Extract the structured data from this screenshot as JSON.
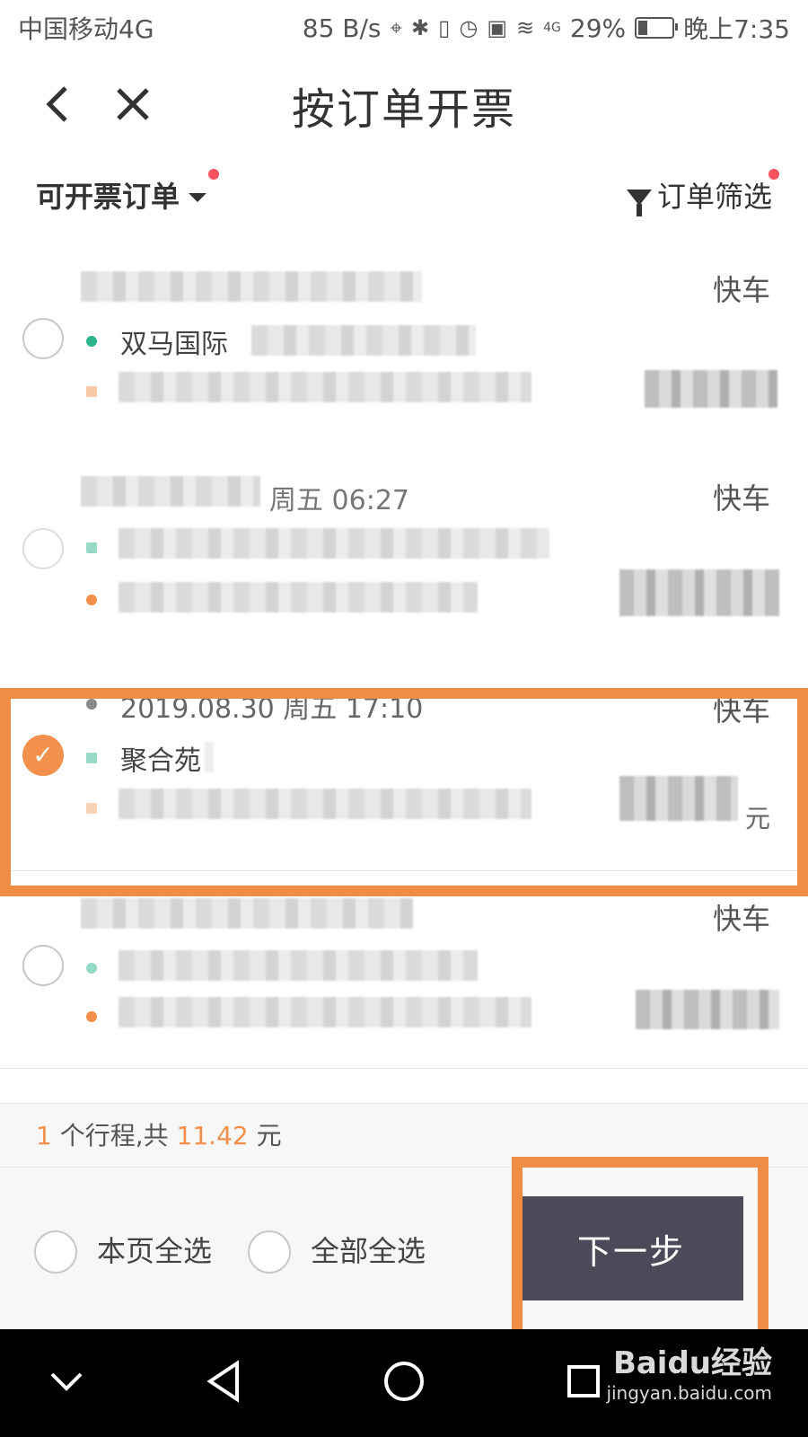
{
  "status_bar": {
    "carrier": "中国移动4G",
    "speed": "85 B/s",
    "signal_label": "4G",
    "battery": "29%",
    "time": "晚上7:35"
  },
  "nav": {
    "title": "按订单开票",
    "back_icon": "chevron-left-icon",
    "close_icon": "close-icon"
  },
  "filter": {
    "left_label": "可开票订单",
    "right_label": "订单筛选"
  },
  "orders": [
    {
      "type": "快车",
      "from": "双马国际",
      "selected": false
    },
    {
      "type": "快车",
      "date_fragment": "周五 06:27",
      "selected": false
    },
    {
      "type": "快车",
      "date": "2019.08.30 周五 17:10",
      "selected": true,
      "from": "聚合苑",
      "unit": "元"
    },
    {
      "type": "快车",
      "selected": false
    }
  ],
  "summary": {
    "count": "1",
    "mid": "个行程,共",
    "amount": "11.42",
    "unit": "元"
  },
  "footer": {
    "select_page": "本页全选",
    "select_all": "全部全选",
    "next": "下一步"
  },
  "watermark": {
    "brand": "Baidu经验",
    "url": "jingyan.baidu.com"
  },
  "colors": {
    "accent": "#f3914c",
    "highlight": "#f08d45",
    "button": "#4a4a58",
    "dot_start": "#2bb48d",
    "dot_end": "#f3914c"
  }
}
